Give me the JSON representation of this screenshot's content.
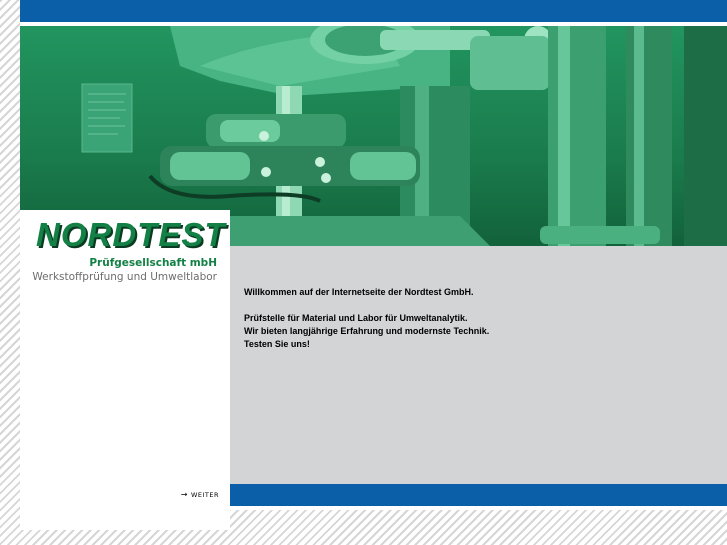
{
  "colors": {
    "brand_blue": "#0a5fa8",
    "brand_green": "#138046",
    "content_gray": "#d3d4d6"
  },
  "logo": {
    "name": "NORDTEST",
    "tagline_company": "Prüfgesellschaft mbH",
    "tagline_services": "Werkstoffprüfung und Umweltlabor"
  },
  "nav": {
    "next_arrow": "→",
    "next_label": "WEITER"
  },
  "content": {
    "welcome": "Willkommen auf der Internetseite der Nordtest GmbH.",
    "line1": "Prüfstelle für Material und Labor für Umweltanalytik.",
    "line2": "Wir bieten langjährige Erfahrung und modernste Technik.",
    "line3": "Testen Sie uns!"
  }
}
